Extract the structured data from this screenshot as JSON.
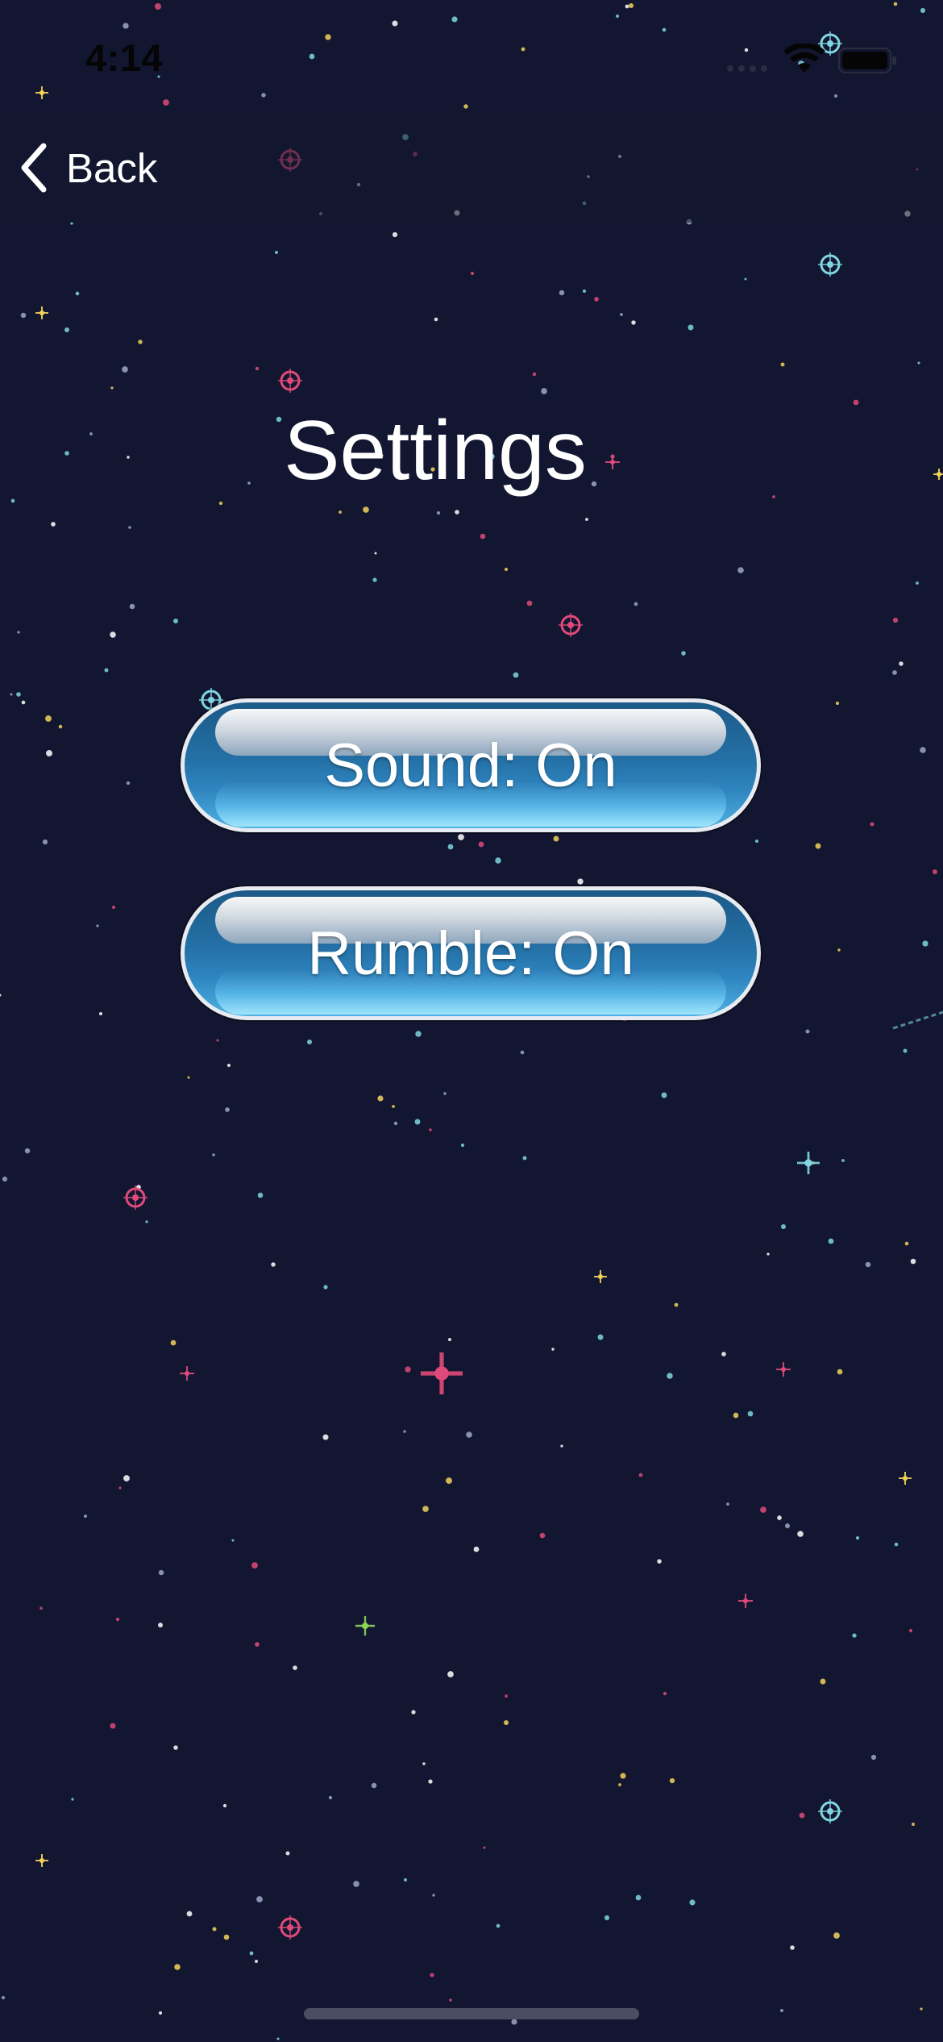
{
  "status_bar": {
    "time": "4:14",
    "icons": [
      "cellular-signal-icon",
      "wifi-icon",
      "battery-icon"
    ]
  },
  "nav": {
    "back_label": "Back",
    "back_icon": "chevron-left-icon"
  },
  "page": {
    "title": "Settings"
  },
  "settings": {
    "sound_label": "Sound: On",
    "rumble_label": "Rumble: On"
  },
  "colors": {
    "background": "#131630",
    "button_blue": "#2470a6",
    "button_border": "#e8ebf0",
    "text": "#ffffff",
    "star_pink": "#e04a7a",
    "star_cyan": "#7fd6e0",
    "star_yellow": "#f2d25a",
    "star_green": "#8ad45a"
  }
}
